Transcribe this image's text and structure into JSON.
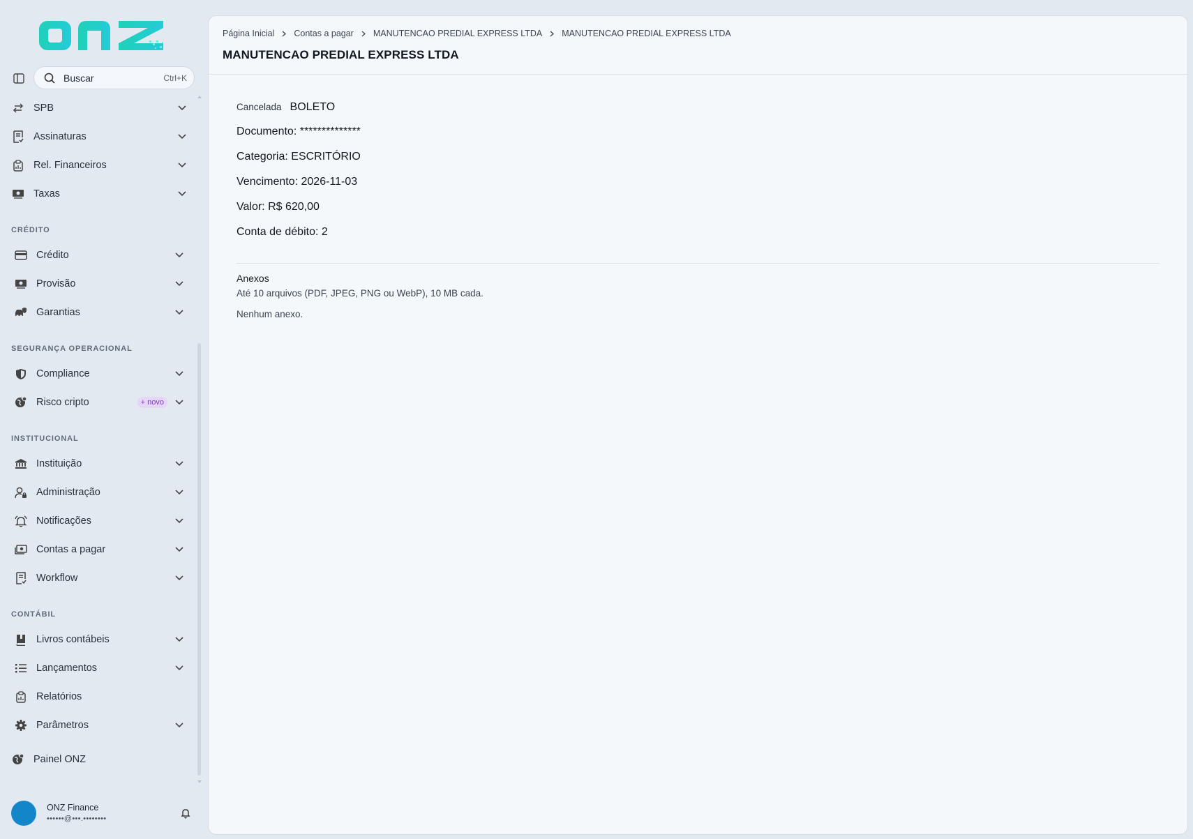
{
  "sidebar": {
    "search": {
      "label": "Buscar",
      "shortcut": "Ctrl+K"
    },
    "items_top": [
      {
        "label": "SPB",
        "icon": "arrows-swap-icon"
      },
      {
        "label": "Assinaturas",
        "icon": "receipt-check-icon"
      },
      {
        "label": "Rel. Financeiros",
        "icon": "clipboard-icon"
      },
      {
        "label": "Taxas",
        "icon": "cash-icon"
      }
    ],
    "sections": {
      "credito": "CRÉDITO",
      "seguranca": "SEGURANÇA OPERACIONAL",
      "institucional": "INSTITUCIONAL",
      "contabil": "CONTÁBIL"
    },
    "credito_items": [
      {
        "label": "Crédito",
        "icon": "card-icon"
      },
      {
        "label": "Provisão",
        "icon": "cash-icon"
      },
      {
        "label": "Garantias",
        "icon": "car-shield-icon"
      }
    ],
    "seguranca_items": [
      {
        "label": "Compliance",
        "icon": "shield-icon"
      },
      {
        "label": "Risco cripto",
        "icon": "globe-icon",
        "badge": "+ novo"
      }
    ],
    "institucional_items": [
      {
        "label": "Instituição",
        "icon": "bank-icon"
      },
      {
        "label": "Administração",
        "icon": "user-lock-icon"
      },
      {
        "label": "Notificações",
        "icon": "bell-icon"
      },
      {
        "label": "Contas a pagar",
        "icon": "bill-icon"
      },
      {
        "label": "Workflow",
        "icon": "receipt-check-icon"
      }
    ],
    "contabil_items": [
      {
        "label": "Livros contábeis",
        "icon": "book-icon"
      },
      {
        "label": "Lançamentos",
        "icon": "list-icon"
      },
      {
        "label": "Relatórios",
        "icon": "clipboard-icon"
      },
      {
        "label": "Parâmetros",
        "icon": "gear-icon"
      }
    ],
    "painel": {
      "label": "Painel ONZ",
      "icon": "globe-icon"
    },
    "profile": {
      "name": "ONZ Finance",
      "email": "••••••@•••.••••••••"
    }
  },
  "main": {
    "breadcrumb": [
      "Página Inicial",
      "Contas a pagar",
      "MANUTENCAO PREDIAL EXPRESS LTDA",
      "MANUTENCAO PREDIAL EXPRESS LTDA"
    ],
    "title": "MANUTENCAO PREDIAL EXPRESS LTDA",
    "status_label": "Cancelada",
    "payment_type": "BOLETO",
    "fields": [
      {
        "key": "Documento: ",
        "value": "**************"
      },
      {
        "key": "Categoria: ",
        "value": "ESCRITÓRIO"
      },
      {
        "key": "Vencimento: ",
        "value": "2026-11-03"
      },
      {
        "key": "Valor: ",
        "value": "R$ 620,00"
      },
      {
        "key": "Conta de débito: ",
        "value": "2"
      }
    ],
    "attachments": {
      "title": "Anexos",
      "hint": "Até 10 arquivos (PDF, JPEG, PNG ou WebP), 10 MB cada.",
      "empty": "Nenhum anexo."
    }
  },
  "colors": {
    "brand": "#1fd1b8",
    "avatar": "#1386c9",
    "badge_bg": "#e5d5f7",
    "badge_text": "#7b3fb8"
  }
}
